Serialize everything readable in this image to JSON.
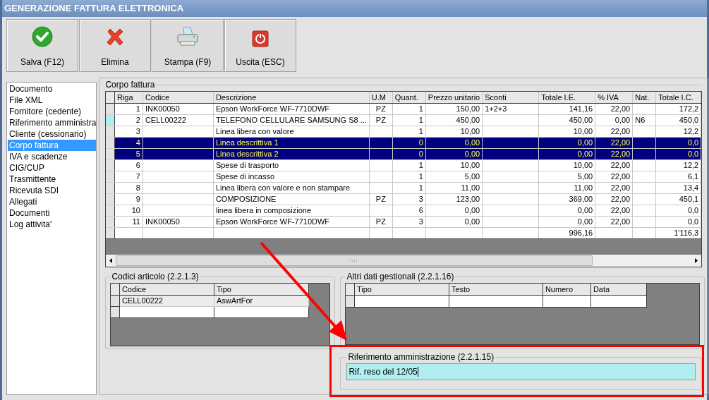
{
  "window": {
    "title": "GENERAZIONE FATTURA ELETTRONICA"
  },
  "toolbar": [
    {
      "label": "Salva (F12)",
      "kind": "save"
    },
    {
      "label": "Elimina",
      "kind": "delete"
    },
    {
      "label": "Stampa (F9)",
      "kind": "print"
    },
    {
      "label": "Uscita (ESC)",
      "kind": "exit"
    }
  ],
  "sidebar": {
    "items": [
      {
        "label": "Documento",
        "selected": false
      },
      {
        "label": "File XML",
        "selected": false
      },
      {
        "label": "Fornitore (cedente)",
        "selected": false
      },
      {
        "label": "Riferimento amministra",
        "selected": false
      },
      {
        "label": "Cliente (cessionario)",
        "selected": false
      },
      {
        "label": "Corpo fattura",
        "selected": true
      },
      {
        "label": "IVA e scadenze",
        "selected": false
      },
      {
        "label": "CIG/CUP",
        "selected": false
      },
      {
        "label": "Trasmittente",
        "selected": false
      },
      {
        "label": "Ricevuta SDI",
        "selected": false
      },
      {
        "label": "Allegati",
        "selected": false
      },
      {
        "label": "Documenti",
        "selected": false
      },
      {
        "label": "Log attivita'",
        "selected": false
      }
    ]
  },
  "corpo_fattura": {
    "title": "Corpo fattura",
    "columns": [
      "Riga",
      "Codice",
      "Descrizione",
      "U.M",
      "Quant.",
      "Prezzo unitario",
      "Sconti",
      "Totale I.E.",
      "% IVA",
      "Nat.",
      "Totale I.C."
    ],
    "rows": [
      {
        "cells": [
          "1",
          "INK00050",
          "Epson WorkForce WF-7710DWF",
          "PZ",
          "1",
          "150,00",
          "1+2+3",
          "141,16",
          "22,00",
          "",
          "172,2"
        ],
        "selected": false,
        "current": false
      },
      {
        "cells": [
          "2",
          "CELL00222",
          "TELEFONO CELLULARE SAMSUNG S8 ...",
          "PZ",
          "1",
          "450,00",
          "",
          "450,00",
          "0,00",
          "N6",
          "450,0"
        ],
        "selected": false,
        "current": true
      },
      {
        "cells": [
          "3",
          "",
          "Linea libera con valore",
          "",
          "1",
          "10,00",
          "",
          "10,00",
          "22,00",
          "",
          "12,2"
        ],
        "selected": false,
        "current": false
      },
      {
        "cells": [
          "4",
          "",
          "Linea descrittiva 1",
          "",
          "0",
          "0,00",
          "",
          "0,00",
          "22,00",
          "",
          "0,0"
        ],
        "selected": true,
        "current": false
      },
      {
        "cells": [
          "5",
          "",
          "Linea descrittiva 2",
          "",
          "0",
          "0,00",
          "",
          "0,00",
          "22,00",
          "",
          "0,0"
        ],
        "selected": true,
        "current": false
      },
      {
        "cells": [
          "6",
          "",
          "Spese di trasporto",
          "",
          "1",
          "10,00",
          "",
          "10,00",
          "22,00",
          "",
          "12,2"
        ],
        "selected": false,
        "current": false
      },
      {
        "cells": [
          "7",
          "",
          "Spese di incasso",
          "",
          "1",
          "5,00",
          "",
          "5,00",
          "22,00",
          "",
          "6,1"
        ],
        "selected": false,
        "current": false
      },
      {
        "cells": [
          "8",
          "",
          "Linea libera con valore e non stampare",
          "",
          "1",
          "11,00",
          "",
          "11,00",
          "22,00",
          "",
          "13,4"
        ],
        "selected": false,
        "current": false
      },
      {
        "cells": [
          "9",
          "",
          "COMPOSIZIONE",
          "PZ",
          "3",
          "123,00",
          "",
          "369,00",
          "22,00",
          "",
          "450,1"
        ],
        "selected": false,
        "current": false
      },
      {
        "cells": [
          "10",
          "",
          "linea libera in composizione",
          "",
          "6",
          "0,00",
          "",
          "0,00",
          "22,00",
          "",
          "0,0"
        ],
        "selected": false,
        "current": false
      },
      {
        "cells": [
          "11",
          "INK00050",
          "Epson WorkForce WF-7710DWF",
          "PZ",
          "3",
          "0,00",
          "",
          "0,00",
          "22,00",
          "",
          "0,0"
        ],
        "selected": false,
        "current": false
      }
    ],
    "totals": {
      "totale_ie": "996,16",
      "totale_ic": "1'116,3"
    }
  },
  "codici_articolo": {
    "title": "Codici articolo (2.2.1.3)",
    "columns": [
      "Codice",
      "Tipo"
    ],
    "rows": [
      {
        "cells": [
          "CELL00222",
          "AswArtFor"
        ]
      }
    ]
  },
  "altri_dati_gestionali": {
    "title": "Altri dati gestionali (2.2.1.16)",
    "columns": [
      "Tipo",
      "Testo",
      "Numero",
      "Data"
    ]
  },
  "riferimento_amministrazione": {
    "title": "Riferimento amministrazione (2.2.1.15)",
    "value": "Rif. reso del 12/05"
  }
}
